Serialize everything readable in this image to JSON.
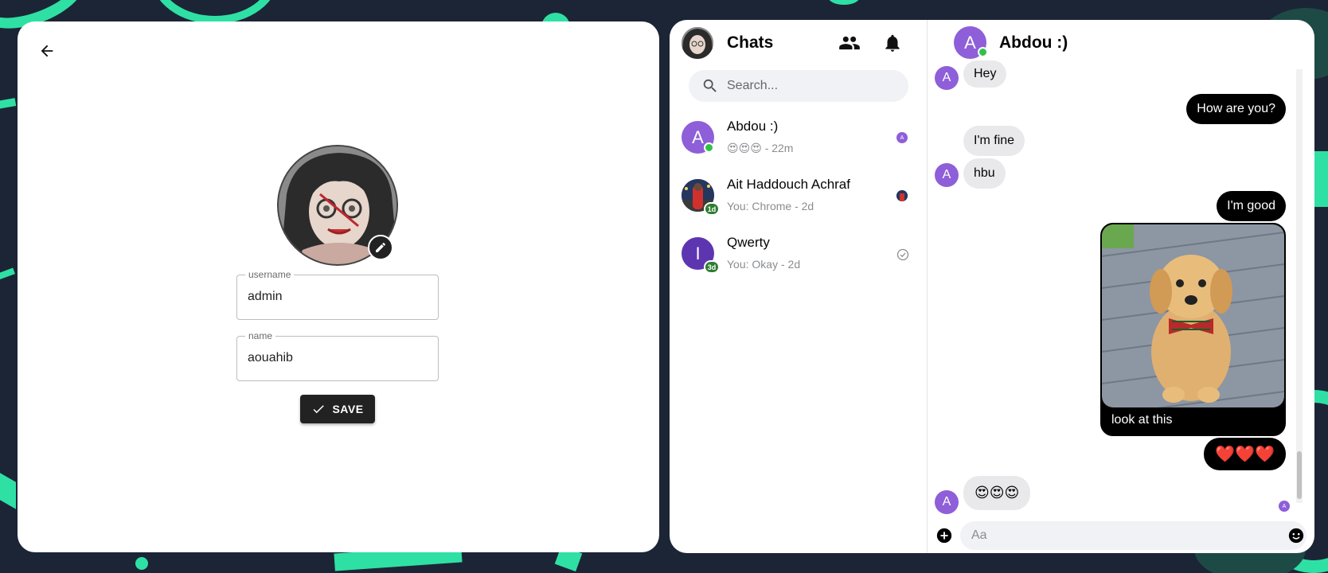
{
  "profile": {
    "username_label": "username",
    "username_value": "admin",
    "name_label": "name",
    "name_value": "aouahib",
    "save_label": "SAVE"
  },
  "sidebar": {
    "title": "Chats",
    "search_placeholder": "Search...",
    "conversations": [
      {
        "initial": "A",
        "name": "Abdou :)",
        "preview": "😍😍😍",
        "time": "- 22m",
        "avatar_color": "#8e5fd8",
        "online": true
      },
      {
        "initial": "",
        "name": "Ait Haddouch Achraf",
        "preview": "You: Chrome",
        "time": "- 2d",
        "badge": "1d"
      },
      {
        "initial": "I",
        "name": "Qwerty",
        "preview": "You: Okay",
        "time": "- 2d",
        "avatar_color": "#5e35b1",
        "badge": "3d"
      }
    ]
  },
  "chat": {
    "contact_initial": "A",
    "contact_name": "Abdou :)",
    "messages": [
      {
        "from": "them",
        "text": "Hey"
      },
      {
        "from": "me",
        "text": "How are you?"
      },
      {
        "from": "them",
        "text": "I'm fine"
      },
      {
        "from": "them",
        "text": "hbu"
      },
      {
        "from": "me",
        "text": "I'm good"
      },
      {
        "from": "me",
        "text": "look at this",
        "has_image": true
      },
      {
        "from": "me",
        "text": "❤️❤️❤️"
      },
      {
        "from": "them",
        "text": "😍😍😍"
      }
    ],
    "composer_placeholder": "Aa",
    "seen_initial": "A"
  },
  "colors": {
    "accent": "#2fe0a4",
    "background": "#1c2536",
    "avatar_purple": "#8e5fd8",
    "online_green": "#31c14b"
  }
}
